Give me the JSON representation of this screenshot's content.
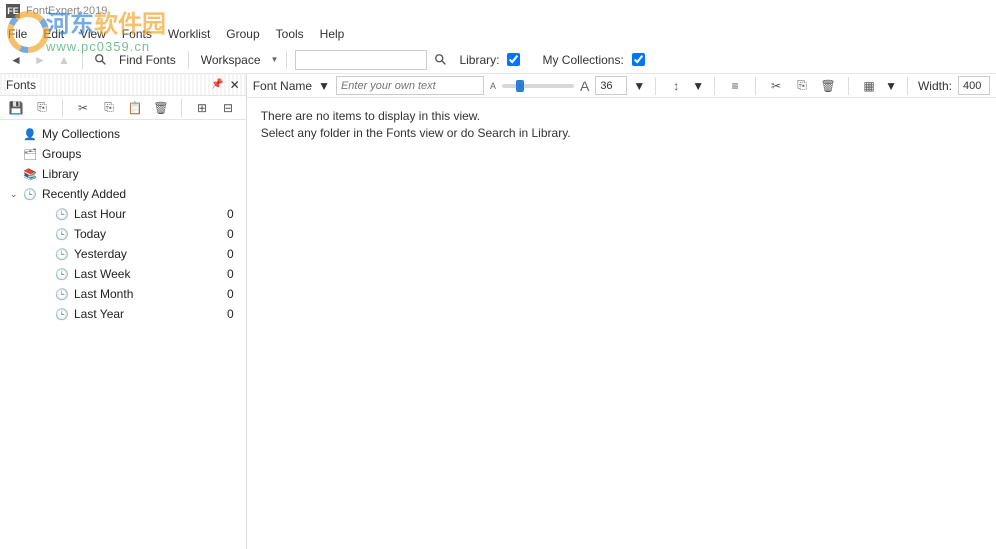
{
  "title": "FontExpert 2019",
  "watermark": {
    "text_a": "河东",
    "text_b": "软件园",
    "url": "www.pc0359.cn"
  },
  "menubar": [
    "File",
    "Edit",
    "View",
    "Fonts",
    "Worklist",
    "Group",
    "Tools",
    "Help"
  ],
  "toolbar": {
    "find_fonts_label": "Find Fonts",
    "workspace_label": "Workspace",
    "library_label": "Library:",
    "library_checked": true,
    "mycollections_label": "My Collections:",
    "mycollections_checked": true
  },
  "left_panel": {
    "title": "Fonts",
    "tree": [
      {
        "icon": "person",
        "label": "My Collections",
        "count": null,
        "indent": 0
      },
      {
        "icon": "cards",
        "label": "Groups",
        "count": null,
        "indent": 0
      },
      {
        "icon": "books",
        "label": "Library",
        "count": null,
        "indent": 0
      },
      {
        "icon": "clock",
        "label": "Recently Added",
        "count": null,
        "indent": 0,
        "expanded": true
      },
      {
        "icon": "clock",
        "label": "Last Hour",
        "count": 0,
        "indent": 1
      },
      {
        "icon": "clock",
        "label": "Today",
        "count": 0,
        "indent": 1
      },
      {
        "icon": "clock",
        "label": "Yesterday",
        "count": 0,
        "indent": 1
      },
      {
        "icon": "clock",
        "label": "Last Week",
        "count": 0,
        "indent": 1
      },
      {
        "icon": "clock",
        "label": "Last Month",
        "count": 0,
        "indent": 1
      },
      {
        "icon": "clock",
        "label": "Last Year",
        "count": 0,
        "indent": 1
      }
    ]
  },
  "right_panel": {
    "property_label": "Font Name",
    "sample_placeholder": "Enter your own text",
    "size_value": "36",
    "width_label": "Width:",
    "width_value": "400",
    "message_1": "There are no items to display in this view.",
    "message_2": "Select any folder in the Fonts view or do Search in Library."
  }
}
